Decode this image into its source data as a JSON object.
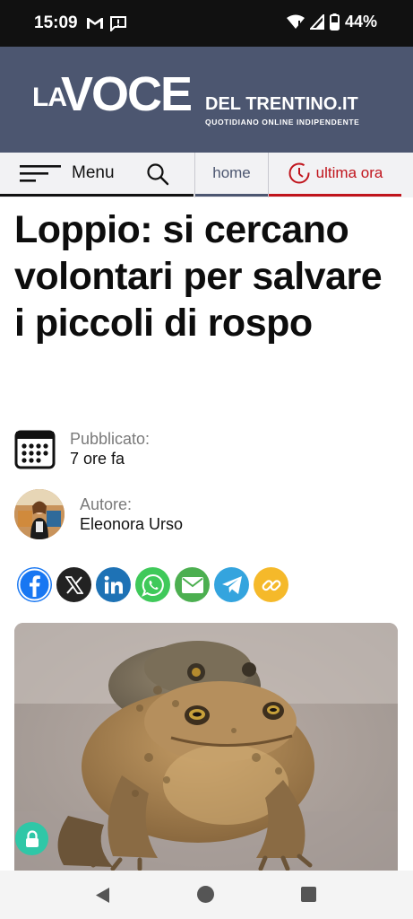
{
  "status_bar": {
    "time": "15:09",
    "battery": "44%"
  },
  "masthead": {
    "logo_la": "LA",
    "logo_voce": "VOCE",
    "logo_del": "DEL TRENTINO.IT",
    "tagline": "QUOTIDIANO  ONLINE  INDIPENDENTE"
  },
  "nav": {
    "menu_label": "Menu",
    "home_label": "home",
    "ultima_label": "ultima ora"
  },
  "article": {
    "title": "Loppio: si cercano volontari per salvare i piccoli di rospo",
    "published_label": "Pubblicato:",
    "published_value": "7 ore fa",
    "author_label": "Autore:",
    "author_name": "Eleonora Urso"
  },
  "share": [
    {
      "icon": "facebook-icon",
      "color": "#1877f2"
    },
    {
      "icon": "x-icon",
      "color": "#222222"
    },
    {
      "icon": "linkedin-icon",
      "color": "#1e72b5"
    },
    {
      "icon": "whatsapp-icon",
      "color": "#3fc95a"
    },
    {
      "icon": "email-icon",
      "color": "#4caf50"
    },
    {
      "icon": "telegram-icon",
      "color": "#34a4de"
    },
    {
      "icon": "copy-link-icon",
      "color": "#f5b92a"
    }
  ],
  "colors": {
    "brand": "#4c5670",
    "accent_red": "#c0141c",
    "lock": "#2fc7a7"
  }
}
